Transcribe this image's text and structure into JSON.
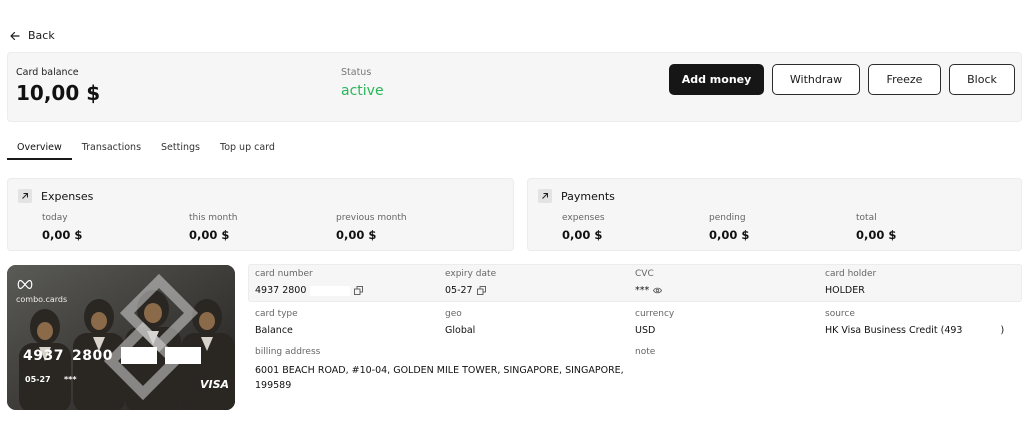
{
  "nav": {
    "back_label": "Back"
  },
  "balance": {
    "label": "Card balance",
    "value": "10,00 $",
    "status_label": "Status",
    "status_value": "active",
    "status_color": "#2bb55b"
  },
  "actions": {
    "add_money": "Add money",
    "withdraw": "Withdraw",
    "freeze": "Freeze",
    "block": "Block"
  },
  "tabs": [
    {
      "label": "Overview",
      "active": true
    },
    {
      "label": "Transactions",
      "active": false
    },
    {
      "label": "Settings",
      "active": false
    },
    {
      "label": "Top up card",
      "active": false
    }
  ],
  "expenses": {
    "title": "Expenses",
    "icon": "arrow-up-right-icon",
    "cols": [
      {
        "label": "today",
        "value": "0,00 $"
      },
      {
        "label": "this month",
        "value": "0,00 $"
      },
      {
        "label": "previous month",
        "value": "0,00 $"
      }
    ]
  },
  "payments": {
    "title": "Payments",
    "icon": "arrow-up-right-icon",
    "cols": [
      {
        "label": "expenses",
        "value": "0,00 $"
      },
      {
        "label": "pending",
        "value": "0,00 $"
      },
      {
        "label": "total",
        "value": "0,00 $"
      }
    ]
  },
  "card": {
    "brand": "combo.cards",
    "number_visible_1": "4937",
    "number_visible_2": "2800",
    "expiry": "05-27",
    "cvc": "***",
    "network": "VISA"
  },
  "details": {
    "card_number": {
      "label": "card number",
      "value": "4937 2800"
    },
    "expiry_date": {
      "label": "expiry date",
      "value": "05-27"
    },
    "cvc": {
      "label": "CVC",
      "value": "***"
    },
    "card_holder": {
      "label": "card holder",
      "value": "HOLDER"
    },
    "card_type": {
      "label": "card type",
      "value": "Balance"
    },
    "geo": {
      "label": "geo",
      "value": "Global"
    },
    "currency": {
      "label": "currency",
      "value": "USD"
    },
    "source": {
      "label": "source",
      "value": "HK Visa Business Credit (493",
      "suffix": ")"
    },
    "billing_address": {
      "label": "billing address",
      "line1": "6001 BEACH ROAD, #10-04, GOLDEN MILE TOWER, SINGAPORE, SINGAPORE,",
      "line2": "199589"
    },
    "note": {
      "label": "note"
    }
  }
}
